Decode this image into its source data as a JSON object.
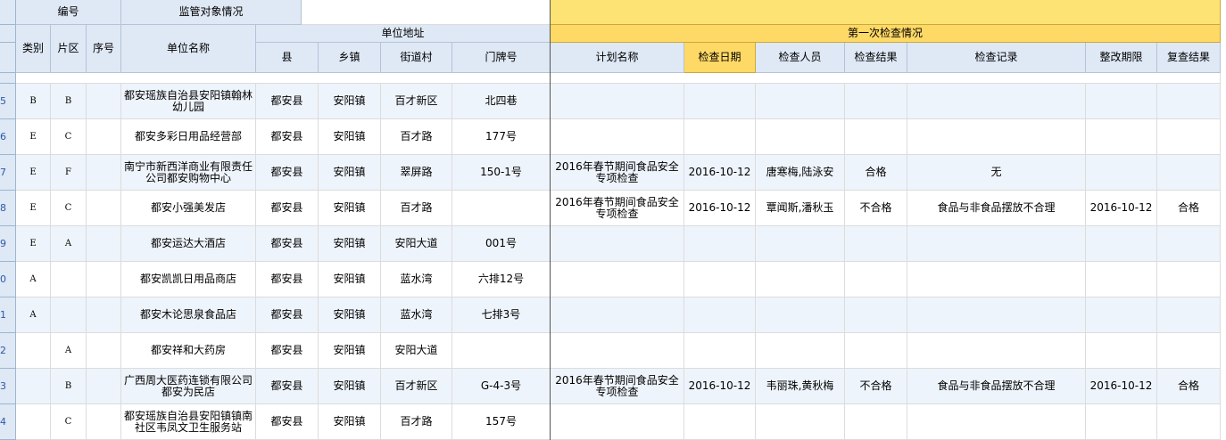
{
  "headers": {
    "code": "编号",
    "supervision": "监管对象情况",
    "blank": "",
    "first_inspection_band": "",
    "first_inspection": "第一次检查情况",
    "category": "类别",
    "district": "片区",
    "serial": "序号",
    "unit_name": "单位名称",
    "unit_address": "单位地址",
    "county": "县",
    "town": "乡镇",
    "street": "街道村",
    "door_no": "门牌号",
    "plan_name": "计划名称",
    "check_date": "检查日期",
    "inspectors": "检查人员",
    "result": "检查结果",
    "record": "检查记录",
    "rectify_deadline": "整改期限",
    "recheck": "复查结果"
  },
  "rows": [
    {
      "num": "5",
      "category": "B",
      "district": "B",
      "serial": "",
      "name": "都安瑶族自治县安阳镇翰林幼儿园",
      "county": "都安县",
      "town": "安阳镇",
      "street": "百才新区",
      "door": "北四巷",
      "plan": "",
      "date": "",
      "inspectors": "",
      "result": "",
      "record": "",
      "deadline": "",
      "recheck": ""
    },
    {
      "num": "6",
      "category": "E",
      "district": "C",
      "serial": "",
      "name": "都安多彩日用品经营部",
      "county": "都安县",
      "town": "安阳镇",
      "street": "百才路",
      "door": "177号",
      "plan": "",
      "date": "",
      "inspectors": "",
      "result": "",
      "record": "",
      "deadline": "",
      "recheck": ""
    },
    {
      "num": "7",
      "category": "E",
      "district": "F",
      "serial": "",
      "name": "南宁市新西洋商业有限责任公司都安购物中心",
      "county": "都安县",
      "town": "安阳镇",
      "street": "翠屏路",
      "door": "150-1号",
      "plan": "2016年春节期间食品安全专项检查",
      "date": "2016-10-12",
      "inspectors": "唐寒梅,陆泳安",
      "result": "合格",
      "record": "无",
      "deadline": "",
      "recheck": ""
    },
    {
      "num": "8",
      "category": "E",
      "district": "C",
      "serial": "",
      "name": "都安小强美发店",
      "county": "都安县",
      "town": "安阳镇",
      "street": "百才路",
      "door": "",
      "plan": "2016年春节期间食品安全专项检查",
      "date": "2016-10-12",
      "inspectors": "覃闻斯,潘秋玉",
      "result": "不合格",
      "record": "食品与非食品摆放不合理",
      "deadline": "2016-10-12",
      "recheck": "合格"
    },
    {
      "num": "9",
      "category": "E",
      "district": "A",
      "serial": "",
      "name": "都安运达大酒店",
      "county": "都安县",
      "town": "安阳镇",
      "street": "安阳大道",
      "door": "001号",
      "plan": "",
      "date": "",
      "inspectors": "",
      "result": "",
      "record": "",
      "deadline": "",
      "recheck": ""
    },
    {
      "num": "0",
      "category": "A",
      "district": "",
      "serial": "",
      "name": "都安凯凯日用品商店",
      "county": "都安县",
      "town": "安阳镇",
      "street": "蓝水湾",
      "door": "六排12号",
      "plan": "",
      "date": "",
      "inspectors": "",
      "result": "",
      "record": "",
      "deadline": "",
      "recheck": ""
    },
    {
      "num": "1",
      "category": "A",
      "district": "",
      "serial": "",
      "name": "都安木论思泉食品店",
      "county": "都安县",
      "town": "安阳镇",
      "street": "蓝水湾",
      "door": "七排3号",
      "plan": "",
      "date": "",
      "inspectors": "",
      "result": "",
      "record": "",
      "deadline": "",
      "recheck": ""
    },
    {
      "num": "2",
      "category": "",
      "district": "A",
      "serial": "",
      "name": "都安祥和大药房",
      "county": "都安县",
      "town": "安阳镇",
      "street": "安阳大道",
      "door": "",
      "plan": "",
      "date": "",
      "inspectors": "",
      "result": "",
      "record": "",
      "deadline": "",
      "recheck": ""
    },
    {
      "num": "3",
      "category": "",
      "district": "B",
      "serial": "",
      "name": "广西周大医药连锁有限公司都安为民店",
      "county": "都安县",
      "town": "安阳镇",
      "street": "百才新区",
      "door": "G-4-3号",
      "plan": "2016年春节期间食品安全专项检查",
      "date": "2016-10-12",
      "inspectors": "韦丽珠,黄秋梅",
      "result": "不合格",
      "record": "食品与非食品摆放不合理",
      "deadline": "2016-10-12",
      "recheck": "合格"
    },
    {
      "num": "4",
      "category": "",
      "district": "C",
      "serial": "",
      "name": "都安瑶族自治县安阳镇镇南社区韦凤文卫生服务站",
      "county": "都安县",
      "town": "安阳镇",
      "street": "百才路",
      "door": "157号",
      "plan": "",
      "date": "",
      "inspectors": "",
      "result": "",
      "record": "",
      "deadline": "",
      "recheck": ""
    }
  ]
}
